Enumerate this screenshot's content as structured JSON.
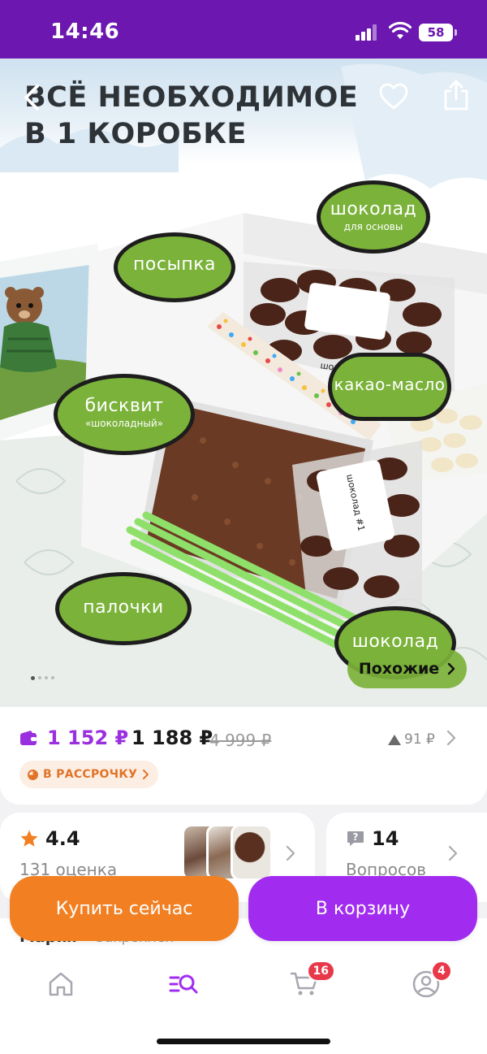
{
  "status_bar": {
    "time": "14:46",
    "battery": "58"
  },
  "hero": {
    "title_line1": "ВСЁ НЕОБХОДИМОЕ",
    "title_line2": "В 1 КОРОБКЕ",
    "labels": {
      "sprinkles": "посыпка",
      "chocolate_base": "шоколад",
      "chocolate_base_sub": "для основы",
      "cocoa_butter": "какао-масло",
      "biscuit": "бисквит",
      "biscuit_sub": "«шоколадный»",
      "sticks": "палочки",
      "chocolate_bottom": "шоколад"
    },
    "package_labels": {
      "choc2": "шоколад #2",
      "choc1": "шоколад #1"
    },
    "similar_button": "Похожие",
    "pages_total": 4,
    "page_active": 1
  },
  "price": {
    "card_price": "1 152 ₽",
    "regular_price": "1 188 ₽",
    "old_price": "4 999 ₽",
    "points": "91 ₽",
    "installment_label": "В РАССРОЧКУ"
  },
  "rating": {
    "value": "4.4",
    "count": "131 оценка"
  },
  "questions": {
    "count": "14",
    "label": "Вопросов"
  },
  "review_peek": {
    "name": "Мария",
    "pinned": "Закреплен"
  },
  "actions": {
    "buy_now": "Купить сейчас",
    "add_to_cart": "В корзину"
  },
  "tabbar": {
    "cart_badge": "16",
    "profile_badge": "4"
  },
  "colors": {
    "brand_purple": "#6b17b0",
    "cart_button": "#a12cf0",
    "buy_button": "#f28023",
    "bubble_green": "#7bb23a"
  }
}
